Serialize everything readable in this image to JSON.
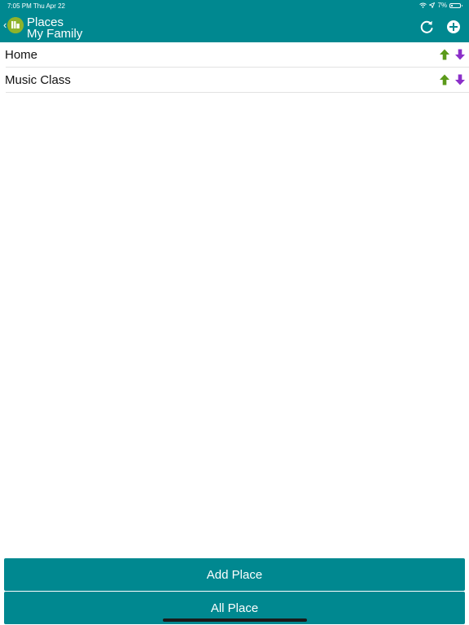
{
  "status_bar": {
    "time": "7:05 PM   Thu Apr 22",
    "battery": "7%"
  },
  "header": {
    "back_symbol": "‹",
    "title": "Places",
    "subtitle": "My Family"
  },
  "places": [
    {
      "name": "Home"
    },
    {
      "name": "Music Class"
    }
  ],
  "actions": {
    "add_place": "Add Place",
    "all_place": "All Place"
  },
  "colors": {
    "primary": "#008890",
    "up_arrow": "#5b9a1a",
    "down_arrow": "#8b2fc9",
    "logo": "#8fb32b"
  },
  "icons": [
    "wifi-icon",
    "location-icon",
    "battery-icon",
    "back-chevron-icon",
    "app-logo-icon",
    "refresh-icon",
    "add-circle-icon",
    "arrow-up-icon",
    "arrow-down-icon"
  ]
}
